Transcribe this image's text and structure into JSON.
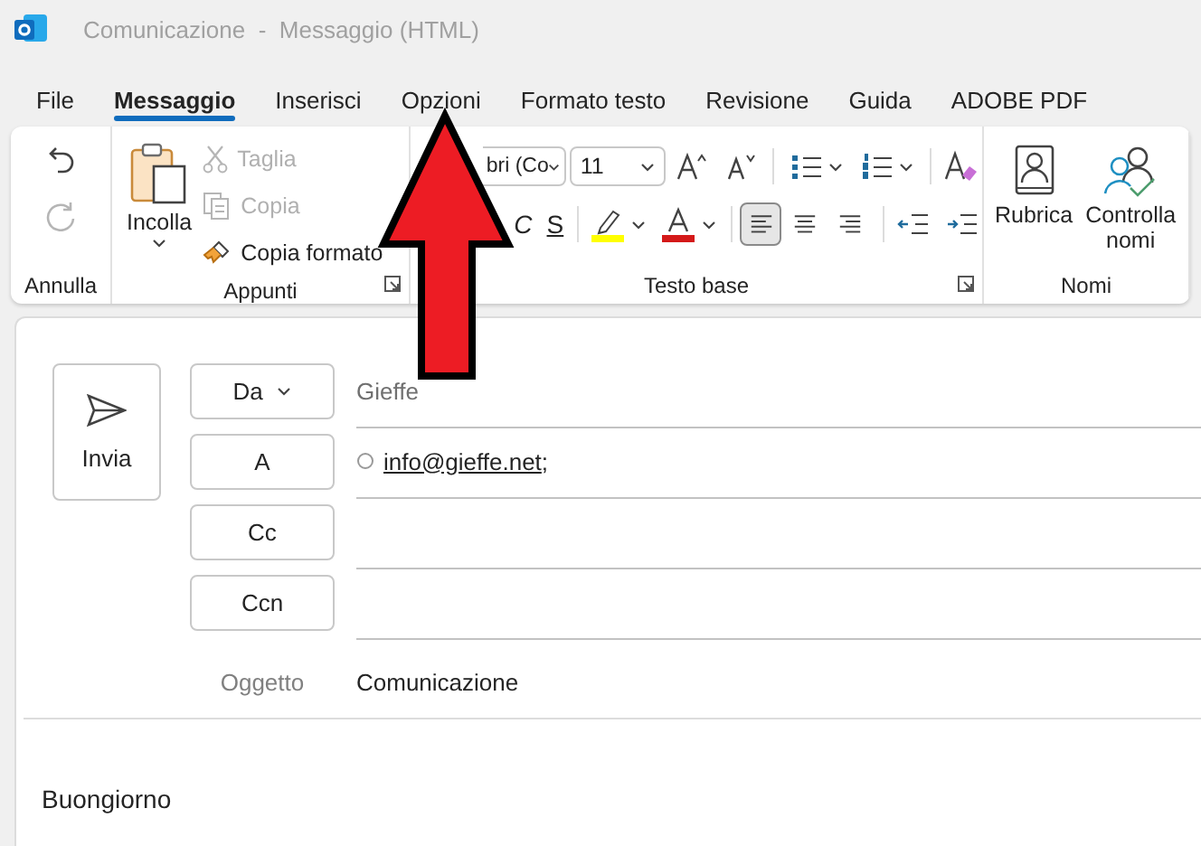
{
  "window": {
    "title": "Comunicazione  -  Messaggio (HTML)"
  },
  "tabs": [
    {
      "label": "File",
      "selected": false
    },
    {
      "label": "Messaggio",
      "selected": true
    },
    {
      "label": "Inserisci",
      "selected": false
    },
    {
      "label": "Opzioni",
      "selected": false
    },
    {
      "label": "Formato testo",
      "selected": false
    },
    {
      "label": "Revisione",
      "selected": false
    },
    {
      "label": "Guida",
      "selected": false
    },
    {
      "label": "ADOBE PDF",
      "selected": false
    }
  ],
  "ribbon": {
    "undo_group": {
      "label": "Annulla",
      "undo_disabled": false,
      "redo_disabled": true
    },
    "clipboard": {
      "label": "Appunti",
      "paste": "Incolla",
      "cut": {
        "label": "Taglia",
        "disabled": true
      },
      "copy": {
        "label": "Copia",
        "disabled": true
      },
      "format_painter": {
        "label": "Copia formato",
        "disabled": false
      }
    },
    "basic_text": {
      "label": "Testo base",
      "font": "bri (Co",
      "size": "11",
      "italic": "C",
      "underline": "S",
      "alignment": [
        {
          "kind": "left",
          "selected": true
        },
        {
          "kind": "center",
          "selected": false
        },
        {
          "kind": "right",
          "selected": false
        }
      ]
    },
    "names": {
      "label": "Nomi",
      "address_book": "Rubrica",
      "check_names": "Controlla nomi"
    }
  },
  "compose": {
    "send": "Invia",
    "from": {
      "button": "Da",
      "value": "Gieffe"
    },
    "to": {
      "button": "A",
      "recipient": "info@gieffe.net",
      "separator": ";"
    },
    "cc": {
      "button": "Cc"
    },
    "bcc": {
      "button": "Ccn"
    },
    "subject": {
      "label": "Oggetto",
      "value": "Comunicazione"
    },
    "body": "Buongiorno"
  },
  "annotation": {
    "kind": "arrow"
  }
}
